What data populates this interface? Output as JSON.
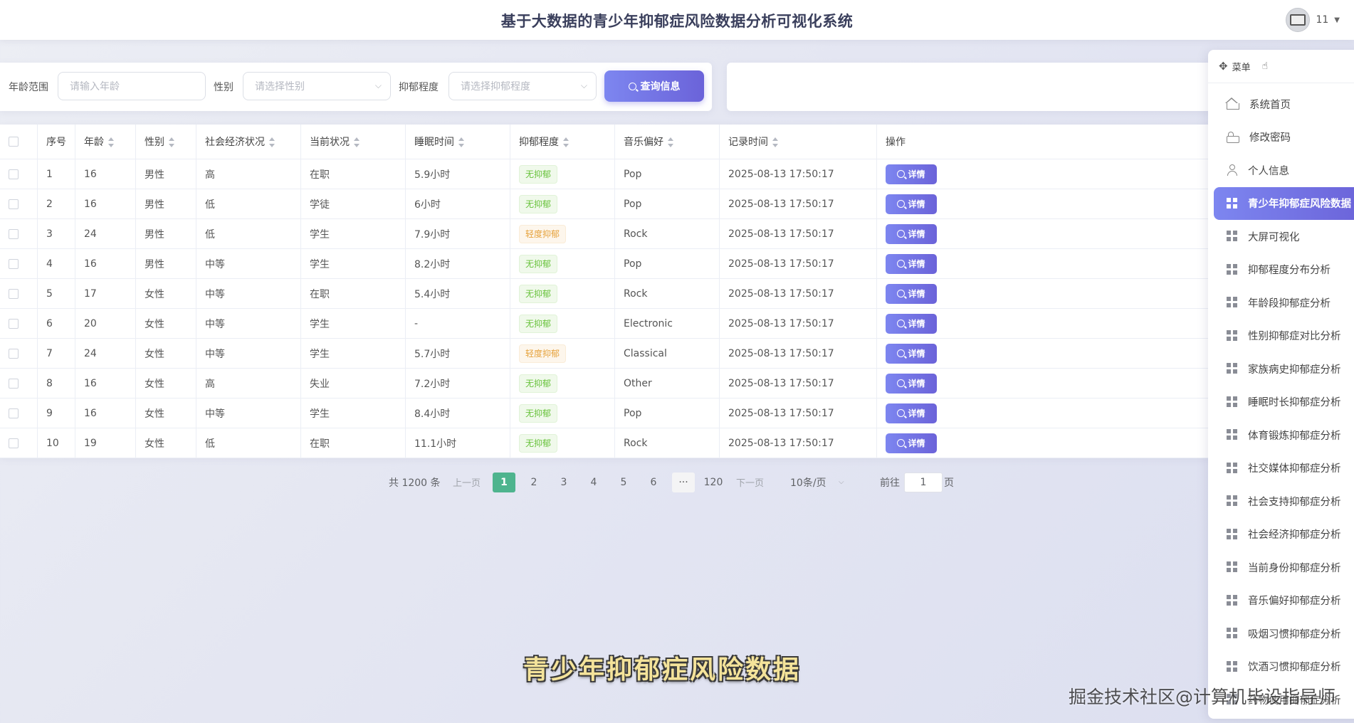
{
  "header": {
    "title": "基于大数据的青少年抑郁症风险数据分析可视化系统",
    "user_name": "11"
  },
  "search": {
    "age_label": "年龄范围",
    "age_placeholder": "请输入年龄",
    "gender_label": "性别",
    "gender_placeholder": "请选择性别",
    "depression_label": "抑郁程度",
    "depression_placeholder": "请选择抑郁程度",
    "query_button": "查询信息"
  },
  "table": {
    "columns": [
      "序号",
      "年龄",
      "性别",
      "社会经济状况",
      "当前状况",
      "睡眠时间",
      "抑郁程度",
      "音乐偏好",
      "记录时间",
      "操作"
    ],
    "detail_label": "详情",
    "rows": [
      {
        "no": "1",
        "age": "16",
        "gender": "男性",
        "ses": "高",
        "status": "在职",
        "sleep": "5.9小时",
        "depression": "无抑郁",
        "level": "none",
        "music": "Pop",
        "time": "2025-08-13 17:50:17"
      },
      {
        "no": "2",
        "age": "16",
        "gender": "男性",
        "ses": "低",
        "status": "学徒",
        "sleep": "6小时",
        "depression": "无抑郁",
        "level": "none",
        "music": "Pop",
        "time": "2025-08-13 17:50:17"
      },
      {
        "no": "3",
        "age": "24",
        "gender": "男性",
        "ses": "低",
        "status": "学生",
        "sleep": "7.9小时",
        "depression": "轻度抑郁",
        "level": "mild",
        "music": "Rock",
        "time": "2025-08-13 17:50:17"
      },
      {
        "no": "4",
        "age": "16",
        "gender": "男性",
        "ses": "中等",
        "status": "学生",
        "sleep": "8.2小时",
        "depression": "无抑郁",
        "level": "none",
        "music": "Pop",
        "time": "2025-08-13 17:50:17"
      },
      {
        "no": "5",
        "age": "17",
        "gender": "女性",
        "ses": "中等",
        "status": "在职",
        "sleep": "5.4小时",
        "depression": "无抑郁",
        "level": "none",
        "music": "Rock",
        "time": "2025-08-13 17:50:17"
      },
      {
        "no": "6",
        "age": "20",
        "gender": "女性",
        "ses": "中等",
        "status": "学生",
        "sleep": "-",
        "depression": "无抑郁",
        "level": "none",
        "music": "Electronic",
        "time": "2025-08-13 17:50:17"
      },
      {
        "no": "7",
        "age": "24",
        "gender": "女性",
        "ses": "中等",
        "status": "学生",
        "sleep": "5.7小时",
        "depression": "轻度抑郁",
        "level": "mild",
        "music": "Classical",
        "time": "2025-08-13 17:50:17"
      },
      {
        "no": "8",
        "age": "16",
        "gender": "女性",
        "ses": "高",
        "status": "失业",
        "sleep": "7.2小时",
        "depression": "无抑郁",
        "level": "none",
        "music": "Other",
        "time": "2025-08-13 17:50:17"
      },
      {
        "no": "9",
        "age": "16",
        "gender": "女性",
        "ses": "中等",
        "status": "学生",
        "sleep": "8.4小时",
        "depression": "无抑郁",
        "level": "none",
        "music": "Pop",
        "time": "2025-08-13 17:50:17"
      },
      {
        "no": "10",
        "age": "19",
        "gender": "女性",
        "ses": "低",
        "status": "在职",
        "sleep": "11.1小时",
        "depression": "无抑郁",
        "level": "none",
        "music": "Rock",
        "time": "2025-08-13 17:50:17"
      }
    ]
  },
  "pagination": {
    "total": "共 1200 条",
    "prev": "上一页",
    "next": "下一页",
    "pages": [
      "1",
      "2",
      "3",
      "4",
      "5",
      "6"
    ],
    "more": "···",
    "last": "120",
    "size": "10条/页",
    "goto": "前往",
    "goto_value": "1",
    "page_unit": "页"
  },
  "menu": {
    "title": "菜单",
    "items": [
      {
        "label": "系统首页",
        "icon": "home-icon"
      },
      {
        "label": "修改密码",
        "icon": "lock-icon"
      },
      {
        "label": "个人信息",
        "icon": "user-icon"
      },
      {
        "label": "青少年抑郁症风险数据",
        "icon": "grid-icon",
        "active": true
      },
      {
        "label": "大屏可视化",
        "icon": "grid-icon"
      },
      {
        "label": "抑郁程度分布分析",
        "icon": "grid-icon"
      },
      {
        "label": "年龄段抑郁症分析",
        "icon": "grid-icon"
      },
      {
        "label": "性别抑郁症对比分析",
        "icon": "grid-icon"
      },
      {
        "label": "家族病史抑郁症分析",
        "icon": "grid-icon"
      },
      {
        "label": "睡眠时长抑郁症分析",
        "icon": "grid-icon"
      },
      {
        "label": "体育锻炼抑郁症分析",
        "icon": "grid-icon"
      },
      {
        "label": "社交媒体抑郁症分析",
        "icon": "grid-icon"
      },
      {
        "label": "社会支持抑郁症分析",
        "icon": "grid-icon"
      },
      {
        "label": "社会经济抑郁症分析",
        "icon": "grid-icon"
      },
      {
        "label": "当前身份抑郁症分析",
        "icon": "grid-icon"
      },
      {
        "label": "音乐偏好抑郁症分析",
        "icon": "grid-icon"
      },
      {
        "label": "吸烟习惯抑郁症分析",
        "icon": "grid-icon"
      },
      {
        "label": "饮酒习惯抑郁症分析",
        "icon": "grid-icon"
      },
      {
        "label": "药物使用抑郁症分析",
        "icon": "grid-icon"
      }
    ]
  },
  "overlay": {
    "subtitle": "青少年抑郁症风险数据",
    "watermark": "掘金技术社区@计算机毕设指导师"
  },
  "colors": {
    "accent": "#6b63d9",
    "active_page": "#4eb48e",
    "tag_none": "#67c23a",
    "tag_mild": "#e6a23c"
  }
}
